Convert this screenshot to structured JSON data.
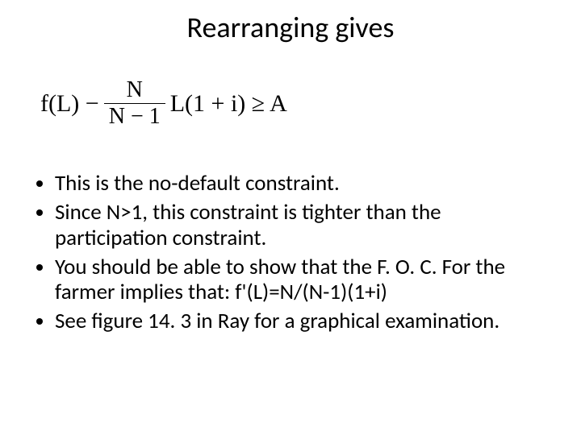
{
  "title": "Rearranging gives",
  "equation": {
    "lhs_prefix": "f(L) −",
    "frac_num": "N",
    "frac_den": "N − 1",
    "lhs_suffix": "L(1 + i) ≥ A"
  },
  "bullets": [
    "This is the no-default constraint.",
    "Since N>1, this constraint is tighter than the participation constraint.",
    "You should be able to show that the F. O. C. For the farmer implies that: f'(L)=N/(N-1)(1+i)",
    "See figure 14. 3 in Ray for a graphical examination."
  ]
}
